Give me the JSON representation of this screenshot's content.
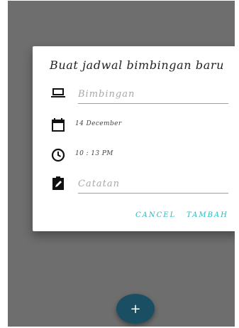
{
  "dialog": {
    "title": "Buat jadwal bimbingan baru",
    "fields": {
      "topic": {
        "placeholder": "Bimbingan",
        "icon": "laptop-icon"
      },
      "date": {
        "value": "14 December",
        "icon": "calendar-icon"
      },
      "time": {
        "value": "10 : 13 PM",
        "icon": "clock-icon"
      },
      "note": {
        "placeholder": "Catatan",
        "icon": "clipboard-edit-icon"
      }
    },
    "actions": {
      "cancel": "CANCEL",
      "add": "TAMBAH"
    },
    "accent_color": "#26b8c2"
  },
  "fab": {
    "label": "+",
    "icon": "plus-icon",
    "color": "#1a4f63"
  },
  "overlay_color": "#6e6e6e"
}
